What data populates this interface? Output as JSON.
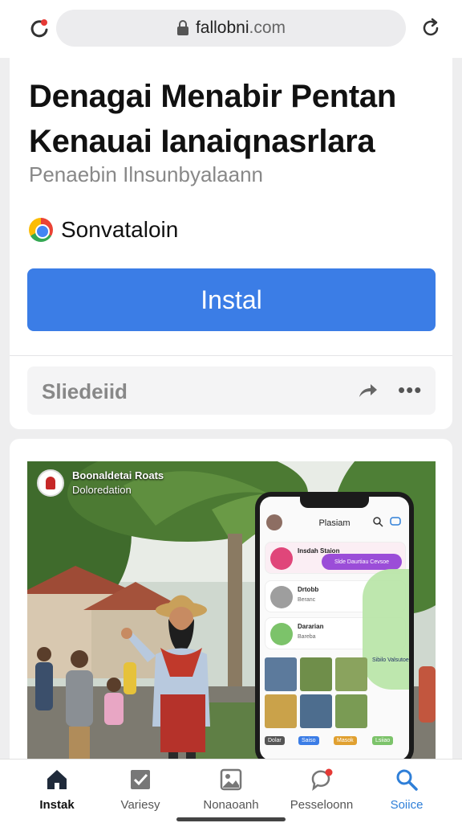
{
  "browser": {
    "url_domain": "fallobni",
    "url_tld": ".com",
    "left_icon": "refresh-red-dot-icon",
    "lock_icon": "lock-icon",
    "right_icon": "reload-icon"
  },
  "app": {
    "title": "Denagai Menabir Pentan Kenauai Ianaiqnasrlara",
    "subtitle": "Penaebin Ilnsunbyalaann",
    "developer": "Sonvataloin",
    "install_label": "Instal",
    "share_label": "Sliedeiid",
    "more_label": "•••"
  },
  "screenshot": {
    "overlay_title": "Boonaldetai Roats",
    "overlay_subtitle": "Doloredation",
    "phone": {
      "header": "Plasiam",
      "row1_title": "Insdah Staion",
      "row1_cta": "Slde Daurtiau Cevsoe",
      "row2_title": "Drtobb",
      "row2_sub": "Beranc",
      "row3_title": "Dararian",
      "row3_sub": "Bareba",
      "panel_text": "Sibilo Valsutoe",
      "tag1": "Dolar",
      "tag2": "Saiso",
      "tag3": "Masok",
      "tag4": "Lsiiao"
    }
  },
  "nav": {
    "items": [
      {
        "label": "Instak",
        "icon": "home-icon"
      },
      {
        "label": "Variesy",
        "icon": "checkbox-icon"
      },
      {
        "label": "Nonaoanh",
        "icon": "gallery-icon"
      },
      {
        "label": "Pesseloonn",
        "icon": "chat-notification-icon"
      },
      {
        "label": "Soiice",
        "icon": "search-icon"
      }
    ]
  },
  "colors": {
    "install_blue": "#3b7de6",
    "search_blue": "#2f7fd8",
    "cta_purple": "#9b4dd8",
    "panel_green": "#b7e4a5"
  }
}
